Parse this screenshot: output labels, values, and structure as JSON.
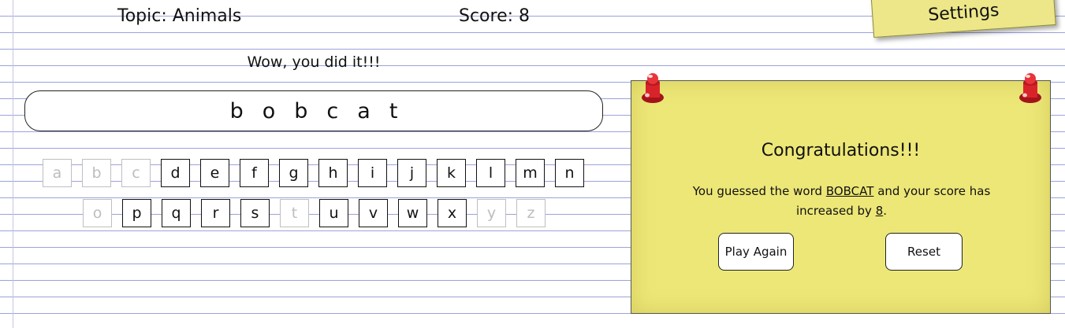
{
  "header": {
    "topic": "Topic: Animals",
    "score": "Score: 8",
    "settings_label": "Settings"
  },
  "game": {
    "message": "Wow, you did it!!!",
    "word_letters": [
      "b",
      "o",
      "b",
      "c",
      "a",
      "t"
    ]
  },
  "keyboard": {
    "row1": [
      {
        "letter": "a",
        "used": true
      },
      {
        "letter": "b",
        "used": true
      },
      {
        "letter": "c",
        "used": true
      },
      {
        "letter": "d",
        "used": false
      },
      {
        "letter": "e",
        "used": false
      },
      {
        "letter": "f",
        "used": false
      },
      {
        "letter": "g",
        "used": false
      },
      {
        "letter": "h",
        "used": false
      },
      {
        "letter": "i",
        "used": false
      },
      {
        "letter": "j",
        "used": false
      },
      {
        "letter": "k",
        "used": false
      },
      {
        "letter": "l",
        "used": false
      },
      {
        "letter": "m",
        "used": false
      },
      {
        "letter": "n",
        "used": false
      }
    ],
    "row2": [
      {
        "letter": "o",
        "used": true
      },
      {
        "letter": "p",
        "used": false
      },
      {
        "letter": "q",
        "used": false
      },
      {
        "letter": "r",
        "used": false
      },
      {
        "letter": "s",
        "used": false
      },
      {
        "letter": "t",
        "used": true
      },
      {
        "letter": "u",
        "used": false
      },
      {
        "letter": "v",
        "used": false
      },
      {
        "letter": "w",
        "used": false
      },
      {
        "letter": "x",
        "used": false
      },
      {
        "letter": "y",
        "used": true
      },
      {
        "letter": "z",
        "used": true
      }
    ]
  },
  "result_note": {
    "title": "Congratulations!!!",
    "text_prefix": "You guessed the word",
    "word": "BOBCAT",
    "text_middle": "and your score has increased by",
    "points": "8",
    "text_suffix": ".",
    "play_again_label": "Play Again",
    "reset_label": "Reset"
  },
  "colors": {
    "note_yellow": "#ede778",
    "settings_yellow": "#ede78a",
    "rule_line": "#9aa3dc",
    "pin_red": "#d9232a",
    "used_key_gray": "#bdbdbd"
  }
}
